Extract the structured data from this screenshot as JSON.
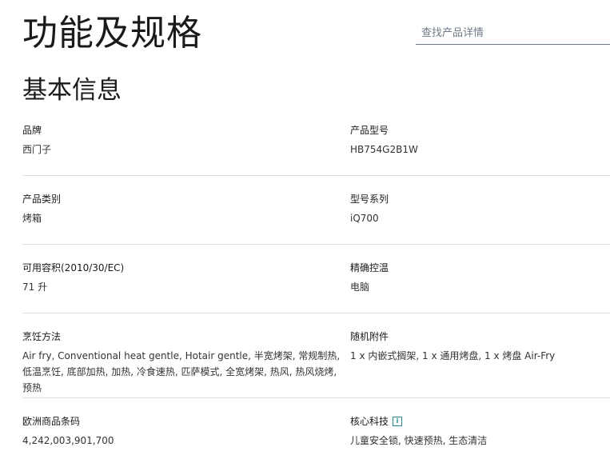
{
  "header": {
    "title": "功能及规格",
    "search_placeholder": "查找产品详情"
  },
  "section": {
    "title": "基本信息"
  },
  "specs": [
    {
      "left": {
        "label": "品牌",
        "value": "西门子"
      },
      "right": {
        "label": "产品型号",
        "value": "HB754G2B1W"
      }
    },
    {
      "left": {
        "label": "产品类别",
        "value": "烤箱"
      },
      "right": {
        "label": "型号系列",
        "value": "iQ700"
      }
    },
    {
      "left": {
        "label": "可用容积(2010/30/EC)",
        "value": "71 升"
      },
      "right": {
        "label": "精确控温",
        "value": "电脑"
      }
    },
    {
      "left": {
        "label": "烹饪方法",
        "value": "Air fry, Conventional heat gentle, Hotair gentle, 半宽烤架, 常规制热, 低温烹饪, 底部加热, 加热, 冷食速热, 匹萨模式, 全宽烤架, 热风, 热风烧烤, 预热"
      },
      "right": {
        "label": "随机附件",
        "value": "1 x 内嵌式搁架, 1 x 通用烤盘, 1 x 烤盘 Air-Fry"
      }
    },
    {
      "left": {
        "label": "欧洲商品条码",
        "value": "4,242,003,901,700"
      },
      "right": {
        "label": "核心科技",
        "value": "儿童安全锁, 快速预热, 生态清洁",
        "info_icon": "i"
      }
    }
  ]
}
